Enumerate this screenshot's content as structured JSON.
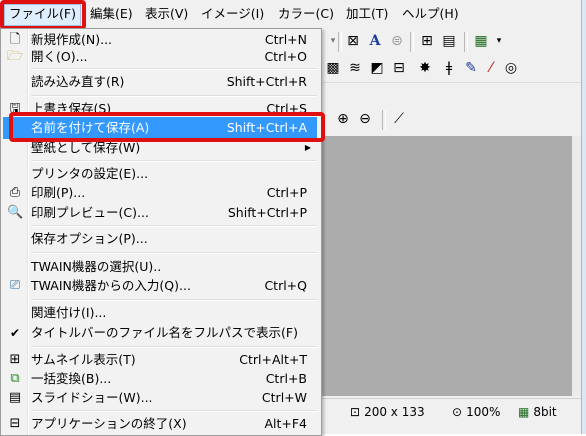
{
  "menubar": {
    "items": [
      {
        "label": "ファイル(F)",
        "active": true
      },
      {
        "label": "編集(E)"
      },
      {
        "label": "表示(V)"
      },
      {
        "label": "イメージ(I)"
      },
      {
        "label": "カラー(C)"
      },
      {
        "label": "加工(T)"
      },
      {
        "label": "ヘルプ(H)"
      }
    ]
  },
  "file_menu": {
    "items": [
      {
        "label": "新規作成(N)...",
        "shortcut": "Ctrl+N",
        "icon": "new-file-icon"
      },
      {
        "label": "開く(O)...",
        "shortcut": "Ctrl+O",
        "icon": "open-folder-icon"
      },
      {
        "label": "読み込み直す(R)",
        "shortcut": "Shift+Ctrl+R"
      },
      {
        "label": "上書き保存(S)",
        "shortcut": "Ctrl+S",
        "icon": "save-disk-icon"
      },
      {
        "label": "名前を付けて保存(A)",
        "shortcut": "Shift+Ctrl+A",
        "selected": true
      },
      {
        "label": "壁紙として保存(W)",
        "submenu": true
      },
      {
        "label": "プリンタの設定(E)..."
      },
      {
        "label": "印刷(P)...",
        "shortcut": "Ctrl+P",
        "icon": "printer-icon"
      },
      {
        "label": "印刷プレビュー(C)...",
        "shortcut": "Shift+Ctrl+P",
        "icon": "print-preview-icon"
      },
      {
        "label": "保存オプション(P)..."
      },
      {
        "label": "TWAIN機器の選択(U).."
      },
      {
        "label": "TWAIN機器からの入力(Q)...",
        "shortcut": "Ctrl+Q",
        "icon": "scanner-icon"
      },
      {
        "label": "関連付け(I)..."
      },
      {
        "label": "タイトルバーのファイル名をフルパスで表示(F)",
        "checked": true
      },
      {
        "label": "サムネイル表示(T)",
        "shortcut": "Ctrl+Alt+T",
        "icon": "thumbnail-grid-icon"
      },
      {
        "label": "一括変換(B)...",
        "shortcut": "Ctrl+B",
        "icon": "batch-convert-icon"
      },
      {
        "label": "スライドショー(W)...",
        "shortcut": "Ctrl+W",
        "icon": "slideshow-icon"
      },
      {
        "label": "アプリケーションの終了(X)",
        "shortcut": "Alt+F4",
        "icon": "exit-icon"
      }
    ]
  },
  "statusbar": {
    "dimensions": "200 x 133",
    "zoom": "100%",
    "depth": "8bit"
  },
  "colors": {
    "highlight": "#3399ff",
    "annotation": "#e01010",
    "canvas": "#acacac"
  }
}
